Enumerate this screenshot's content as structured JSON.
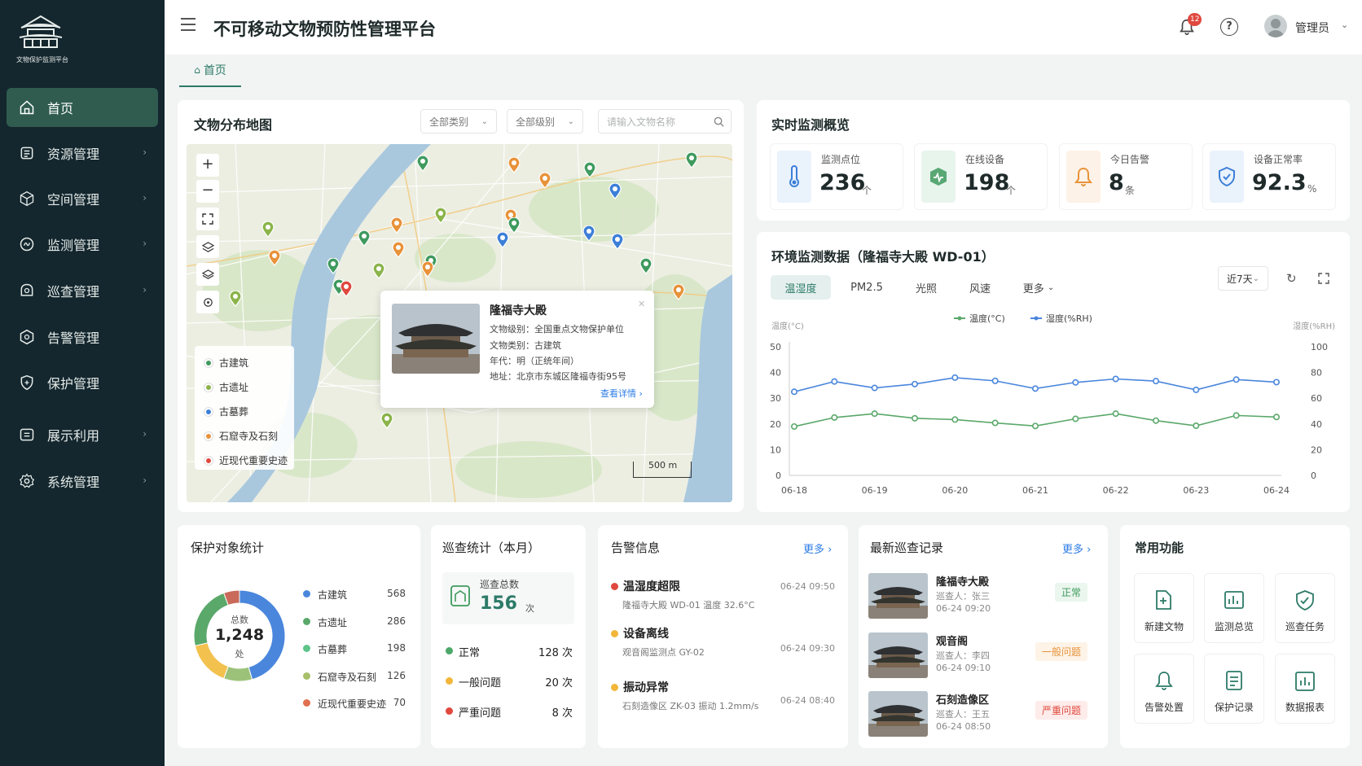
{
  "app": {
    "title": "不可移动文物预防性管理平台",
    "logo_text": "文物保护监测平台"
  },
  "sidebar": {
    "items": [
      {
        "label": "首页",
        "icon": "home-icon"
      },
      {
        "label": "资源管理",
        "icon": "database-icon"
      },
      {
        "label": "空间管理",
        "icon": "cube-icon"
      },
      {
        "label": "监测管理",
        "icon": "monitor-icon"
      },
      {
        "label": "巡查管理",
        "icon": "patrol-icon"
      },
      {
        "label": "告警管理",
        "icon": "alert-icon"
      },
      {
        "label": "保护管理",
        "icon": "shield-icon"
      },
      {
        "label": "展示利用",
        "icon": "display-icon"
      },
      {
        "label": "系统管理",
        "icon": "settings-icon"
      }
    ]
  },
  "header": {
    "notification_count": "12",
    "user_name": "管理员"
  },
  "tabs": [
    {
      "label": "首页"
    }
  ],
  "map": {
    "title": "文物分布地图",
    "filter_category": "全部类别",
    "filter_level": "全部级别",
    "search_placeholder": "请输入文物名称",
    "scale": "500 m",
    "legend": [
      {
        "label": "古建筑",
        "color": "#3f9a5e"
      },
      {
        "label": "古遗址",
        "color": "#8bb44a"
      },
      {
        "label": "古墓葬",
        "color": "#3c7fd8"
      },
      {
        "label": "石窟寺及石刻",
        "color": "#e8923a"
      },
      {
        "label": "近现代重要史迹",
        "color": "#e0483e"
      }
    ],
    "popup": {
      "name": "隆福寺大殿",
      "level": "文物级别：全国重点文物保护单位",
      "category": "文物类别：古建筑",
      "era": "年代：明（正统年间）",
      "address": "地址：北京市东城区隆福寺街95号",
      "link": "查看详情 ›"
    }
  },
  "overview": {
    "title": "实时监测概览",
    "stats": [
      {
        "label": "监测点位",
        "value": "236",
        "unit": "个",
        "icon": "thermometer-icon",
        "color": "#3c7fd8",
        "bg": "#eaf2fc"
      },
      {
        "label": "在线设备",
        "value": "198",
        "unit": "个",
        "icon": "device-icon",
        "color": "#3f9a5e",
        "bg": "#e8f5ed"
      },
      {
        "label": "今日告警",
        "value": "8",
        "unit": "条",
        "icon": "bell-icon",
        "color": "#e8923a",
        "bg": "#fdf2e7"
      },
      {
        "label": "设备正常率",
        "value": "92.3",
        "unit": "%",
        "icon": "shield-check-icon",
        "color": "#3c7fd8",
        "bg": "#eaf2fc"
      }
    ]
  },
  "env": {
    "title": "环境监测数据（隆福寺大殿 WD-01）",
    "tabs": [
      "温湿度",
      "PM2.5",
      "光照",
      "风速",
      "更多"
    ],
    "range": "近7天"
  },
  "chart_data": {
    "type": "line",
    "x": [
      "06-18",
      "06-18b",
      "06-19",
      "06-19b",
      "06-20",
      "06-20b",
      "06-21",
      "06-21b",
      "06-22",
      "06-22b",
      "06-23",
      "06-23b"
    ],
    "xticks": [
      "06-18",
      "06-19",
      "06-20",
      "06-21",
      "06-22",
      "06-23",
      "06-24"
    ],
    "ylabel_left": "温度(°C)",
    "ylabel_right": "湿度(%RH)",
    "ylim_left": [
      0,
      50
    ],
    "ylim_right": [
      0,
      100
    ],
    "yticks_left": [
      50,
      40,
      30,
      20,
      10,
      0
    ],
    "yticks_right": [
      100,
      80,
      60,
      40,
      20,
      0
    ],
    "series": [
      {
        "name": "温度(°C)",
        "axis": "left",
        "color": "#5aa86a",
        "values": [
          19,
          22.5,
          24,
          22.2,
          21.7,
          20.4,
          19.2,
          22,
          24,
          21.3,
          19.3,
          23.3,
          22.7
        ]
      },
      {
        "name": "湿度(%RH)",
        "axis": "right",
        "color": "#4a86dc",
        "values": [
          65,
          73,
          68,
          71,
          76,
          73.5,
          67.5,
          72.3,
          75,
          73.3,
          66.5,
          74.5,
          72.5
        ]
      }
    ]
  },
  "protect": {
    "title": "保护对象统计",
    "total_label": "总数",
    "total": "1,248",
    "unit": "处",
    "items": [
      {
        "label": "古建筑",
        "value": 568,
        "color": "#4a86dc"
      },
      {
        "label": "古遗址",
        "value": 286,
        "color": "#5aa86a"
      },
      {
        "label": "古墓葬",
        "value": 198,
        "color": "#5ec48a"
      },
      {
        "label": "石窟寺及石刻",
        "value": 126,
        "color": "#a8c06a"
      },
      {
        "label": "近现代重要史迹",
        "value": 70,
        "color": "#e07050"
      }
    ],
    "ring_colors": [
      "#4a86dc",
      "#9cc27a",
      "#f2c14e",
      "#5aa86a",
      "#c96a5a"
    ],
    "ring_values": [
      568,
      126,
      198,
      286,
      70
    ]
  },
  "patrol": {
    "title": "巡查统计（本月）",
    "total_label": "巡查总数",
    "total": "156",
    "total_unit": "次",
    "rows": [
      {
        "label": "正常",
        "value": "128 次",
        "color": "#4ca86a"
      },
      {
        "label": "一般问题",
        "value": "20 次",
        "color": "#f2b63a"
      },
      {
        "label": "严重问题",
        "value": "8 次",
        "color": "#e0483e"
      }
    ]
  },
  "alarms": {
    "title": "告警信息",
    "more": "更多 ›",
    "items": [
      {
        "title": "温湿度超限",
        "desc": "隆福寺大殿 WD-01 温度 32.6°C",
        "time": "06-24 09:50",
        "color": "#e0483e"
      },
      {
        "title": "设备离线",
        "desc": "观音阁监测点 GY-02",
        "time": "06-24 09:30",
        "color": "#f2b63a"
      },
      {
        "title": "振动异常",
        "desc": "石刻造像区 ZK-03 振动 1.2mm/s",
        "time": "06-24 08:40",
        "color": "#f2b63a"
      }
    ]
  },
  "records": {
    "title": "最新巡查记录",
    "more": "更多 ›",
    "items": [
      {
        "name": "隆福寺大殿",
        "person": "巡查人：张三",
        "time": "06-24 09:20",
        "status": "正常",
        "color": "#3f9a5e",
        "bg": "#eaf6ee"
      },
      {
        "name": "观音阁",
        "person": "巡查人：李四",
        "time": "06-24 09:10",
        "status": "一般问题",
        "color": "#e8923a",
        "bg": "#fdf3e6"
      },
      {
        "name": "石刻造像区",
        "person": "巡查人：王五",
        "time": "06-24 08:50",
        "status": "严重问题",
        "color": "#e0483e",
        "bg": "#fdecea"
      }
    ]
  },
  "quick": {
    "title": "常用功能",
    "items": [
      {
        "label": "新建文物",
        "icon": "add-file-icon"
      },
      {
        "label": "监测总览",
        "icon": "chart-icon"
      },
      {
        "label": "巡查任务",
        "icon": "task-icon"
      },
      {
        "label": "告警处置",
        "icon": "bell-icon"
      },
      {
        "label": "保护记录",
        "icon": "record-icon"
      },
      {
        "label": "数据报表",
        "icon": "report-icon"
      }
    ]
  }
}
